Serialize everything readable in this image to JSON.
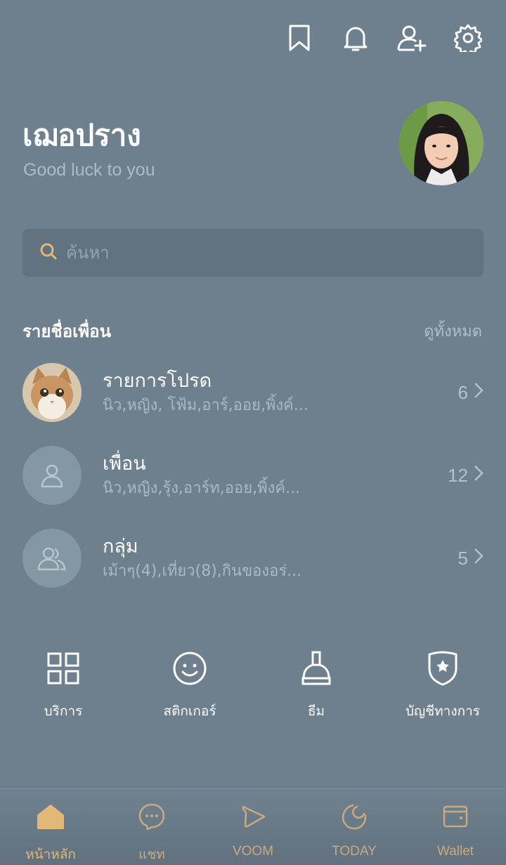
{
  "colors": {
    "background": "#6e7f8d",
    "accent": "#e2b878",
    "tab_inactive": "#c8aa80"
  },
  "header": {
    "icons": [
      "bookmark-icon",
      "bell-icon",
      "add-friend-icon",
      "gear-icon"
    ]
  },
  "profile": {
    "name": "เฌอปราง",
    "status": "Good luck to you"
  },
  "search": {
    "placeholder": "ค้นหา"
  },
  "friends_section": {
    "title": "รายชื่อเพื่อน",
    "see_all": "ดูทั้งหมด",
    "rows": [
      {
        "title": "รายการโปรด",
        "subtitle": "นิว,หญิง, โฟ้ม,อาร์,ออย,พิ้งค์...",
        "count": "6",
        "thumb": "cat-photo"
      },
      {
        "title": "เพื่อน",
        "subtitle": "นิว,หญิง,รุ้ง,อาร์ท,ออย,พิ้งค์...",
        "count": "12",
        "thumb": "person-icon"
      },
      {
        "title": "กลุ่ม",
        "subtitle": "เม้าๆ(4),เที่ยว(8),กินของอร่...",
        "count": "5",
        "thumb": "group-icon"
      }
    ]
  },
  "shortcuts": [
    {
      "label": "บริการ",
      "icon": "grid-icon"
    },
    {
      "label": "สติกเกอร์",
      "icon": "smiley-icon"
    },
    {
      "label": "ธีม",
      "icon": "brush-icon"
    },
    {
      "label": "บัญชีทางการ",
      "icon": "shield-star-icon"
    }
  ],
  "tabs": [
    {
      "label": "หน้าหลัก",
      "icon": "home-icon",
      "active": true
    },
    {
      "label": "แชท",
      "icon": "chat-icon",
      "active": false
    },
    {
      "label": "VOOM",
      "icon": "voom-icon",
      "active": false
    },
    {
      "label": "TODAY",
      "icon": "today-icon",
      "active": false
    },
    {
      "label": "Wallet",
      "icon": "wallet-icon",
      "active": false
    }
  ]
}
